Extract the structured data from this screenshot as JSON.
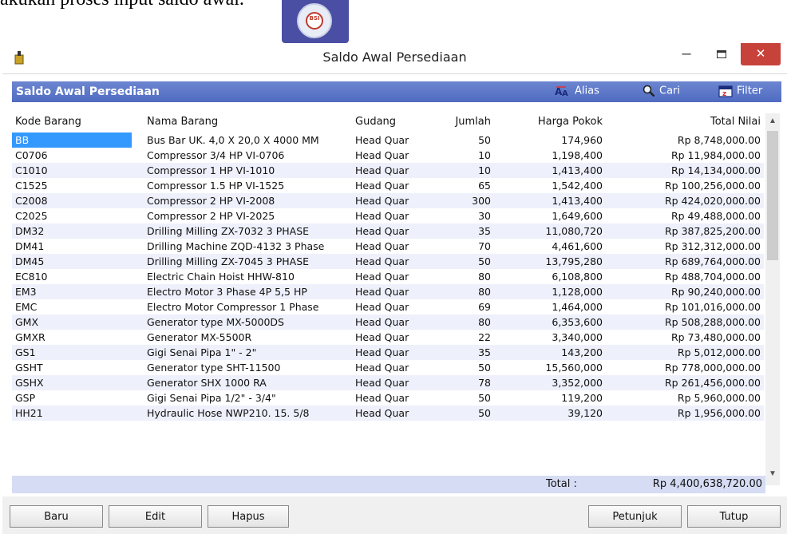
{
  "document": {
    "caption_text": "akukan proses input saldo awal."
  },
  "window": {
    "title": "Saldo Awal Persediaan",
    "minimize_label": "–",
    "close_label": "✕"
  },
  "toolbar": {
    "title": "Saldo Awal Persediaan",
    "alias_label": "Alias",
    "cari_label": "Cari",
    "filter_label": "Filter"
  },
  "table": {
    "columns": [
      "Kode Barang",
      "Nama Barang",
      "Gudang",
      "Jumlah",
      "Harga Pokok",
      "Total Nilai"
    ],
    "rows": [
      {
        "kode": "BB",
        "nama": "Bus Bar UK. 4,0 X 20,0 X 4000 MM",
        "gudang": "Head Quar",
        "jumlah": "50",
        "harga": "174,960",
        "total": "Rp 8,748,000.00"
      },
      {
        "kode": "C0706",
        "nama": "Compressor 3/4 HP VI-0706",
        "gudang": "Head Quar",
        "jumlah": "10",
        "harga": "1,198,400",
        "total": "Rp 11,984,000.00"
      },
      {
        "kode": "C1010",
        "nama": "Compressor 1 HP VI-1010",
        "gudang": "Head Quar",
        "jumlah": "10",
        "harga": "1,413,400",
        "total": "Rp 14,134,000.00"
      },
      {
        "kode": "C1525",
        "nama": "Compressor 1.5 HP VI-1525",
        "gudang": "Head Quar",
        "jumlah": "65",
        "harga": "1,542,400",
        "total": "Rp 100,256,000.00"
      },
      {
        "kode": "C2008",
        "nama": "Compressor 2 HP VI-2008",
        "gudang": "Head Quar",
        "jumlah": "300",
        "harga": "1,413,400",
        "total": "Rp 424,020,000.00"
      },
      {
        "kode": "C2025",
        "nama": "Compressor 2 HP VI-2025",
        "gudang": "Head Quar",
        "jumlah": "30",
        "harga": "1,649,600",
        "total": "Rp 49,488,000.00"
      },
      {
        "kode": "DM32",
        "nama": "Drilling Milling ZX-7032 3 PHASE",
        "gudang": "Head Quar",
        "jumlah": "35",
        "harga": "11,080,720",
        "total": "Rp 387,825,200.00"
      },
      {
        "kode": "DM41",
        "nama": "Drilling Machine ZQD-4132 3 Phase",
        "gudang": "Head Quar",
        "jumlah": "70",
        "harga": "4,461,600",
        "total": "Rp 312,312,000.00"
      },
      {
        "kode": "DM45",
        "nama": "Drilling Milling ZX-7045 3 PHASE",
        "gudang": "Head Quar",
        "jumlah": "50",
        "harga": "13,795,280",
        "total": "Rp 689,764,000.00"
      },
      {
        "kode": "EC810",
        "nama": "Electric Chain Hoist HHW-810",
        "gudang": "Head Quar",
        "jumlah": "80",
        "harga": "6,108,800",
        "total": "Rp 488,704,000.00"
      },
      {
        "kode": "EM3",
        "nama": "Electro Motor 3 Phase 4P 5,5 HP",
        "gudang": "Head Quar",
        "jumlah": "80",
        "harga": "1,128,000",
        "total": "Rp 90,240,000.00"
      },
      {
        "kode": "EMC",
        "nama": "Electro Motor Compressor 1 Phase",
        "gudang": "Head Quar",
        "jumlah": "69",
        "harga": "1,464,000",
        "total": "Rp 101,016,000.00"
      },
      {
        "kode": "GMX",
        "nama": "Generator type MX-5000DS",
        "gudang": "Head Quar",
        "jumlah": "80",
        "harga": "6,353,600",
        "total": "Rp 508,288,000.00"
      },
      {
        "kode": "GMXR",
        "nama": "Generator MX-5500R",
        "gudang": "Head Quar",
        "jumlah": "22",
        "harga": "3,340,000",
        "total": "Rp 73,480,000.00"
      },
      {
        "kode": "GS1",
        "nama": "Gigi Senai Pipa 1\" - 2\"",
        "gudang": "Head Quar",
        "jumlah": "35",
        "harga": "143,200",
        "total": "Rp 5,012,000.00"
      },
      {
        "kode": "GSHT",
        "nama": "Generator type SHT-11500",
        "gudang": "Head Quar",
        "jumlah": "50",
        "harga": "15,560,000",
        "total": "Rp 778,000,000.00"
      },
      {
        "kode": "GSHX",
        "nama": "Generator SHX 1000 RA",
        "gudang": "Head Quar",
        "jumlah": "78",
        "harga": "3,352,000",
        "total": "Rp 261,456,000.00"
      },
      {
        "kode": "GSP",
        "nama": "Gigi Senai Pipa 1/2\" - 3/4\"",
        "gudang": "Head Quar",
        "jumlah": "50",
        "harga": "119,200",
        "total": "Rp 5,960,000.00"
      },
      {
        "kode": "HH21",
        "nama": "Hydraulic Hose NWP210. 15. 5/8",
        "gudang": "Head Quar",
        "jumlah": "50",
        "harga": "39,120",
        "total": "Rp 1,956,000.00"
      }
    ]
  },
  "totals": {
    "label": "Total :",
    "value": "Rp 4,400,638,720.00"
  },
  "buttons": {
    "baru": "Baru",
    "edit": "Edit",
    "hapus": "Hapus",
    "petunjuk": "Petunjuk",
    "tutup": "Tutup"
  },
  "colors": {
    "toolbar": "#5a74c6",
    "selection": "#3399ff",
    "close": "#c7423a",
    "alt_row": "#eef0fb"
  }
}
